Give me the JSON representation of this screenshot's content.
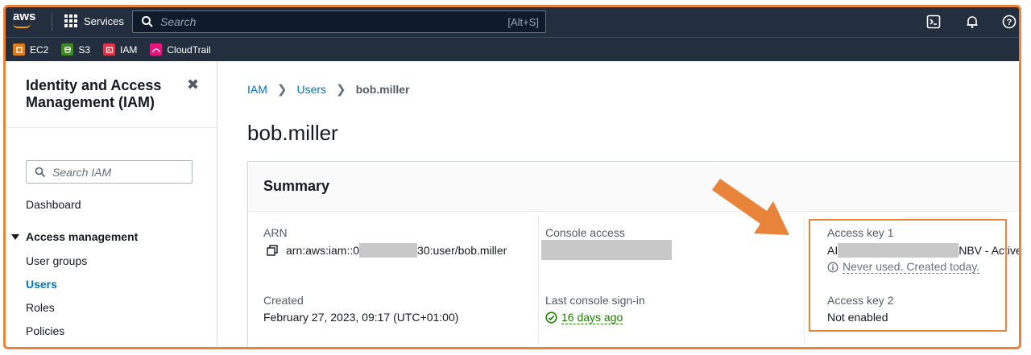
{
  "topnav": {
    "logo_text": "aws",
    "services_label": "Services",
    "search_placeholder": "Search",
    "search_shortcut": "[Alt+S]"
  },
  "favorites": [
    {
      "label": "EC2",
      "color": "#e07b19"
    },
    {
      "label": "S3",
      "color": "#3f8624"
    },
    {
      "label": "IAM",
      "color": "#dd344c"
    },
    {
      "label": "CloudTrail",
      "color": "#e7157b"
    }
  ],
  "sidebar": {
    "title": "Identity and Access Management (IAM)",
    "search_placeholder": "Search IAM",
    "dashboard": "Dashboard",
    "section_label": "Access management",
    "items": [
      "User groups",
      "Users",
      "Roles",
      "Policies"
    ]
  },
  "breadcrumb": {
    "root": "IAM",
    "parent": "Users",
    "current": "bob.miller"
  },
  "page": {
    "title": "bob.miller"
  },
  "summary": {
    "title": "Summary",
    "arn_label": "ARN",
    "arn_prefix": "arn:aws:iam::0",
    "arn_suffix": "30:user/bob.miller",
    "created_label": "Created",
    "created_value": "February 27, 2023, 09:17 (UTC+01:00)",
    "console_access_label": "Console access",
    "last_signin_label": "Last console sign-in",
    "last_signin_value": "16 days ago",
    "access_key1_label": "Access key 1",
    "access_key1_prefix": "AI",
    "access_key1_suffix": "NBV - Active",
    "access_key1_note": "Never used. Created today.",
    "access_key2_label": "Access key 2",
    "access_key2_value": "Not enabled"
  },
  "colors": {
    "nav_bg": "#232f3e",
    "link": "#0073bb",
    "success": "#1d8102",
    "annotation": "#e8833a"
  }
}
